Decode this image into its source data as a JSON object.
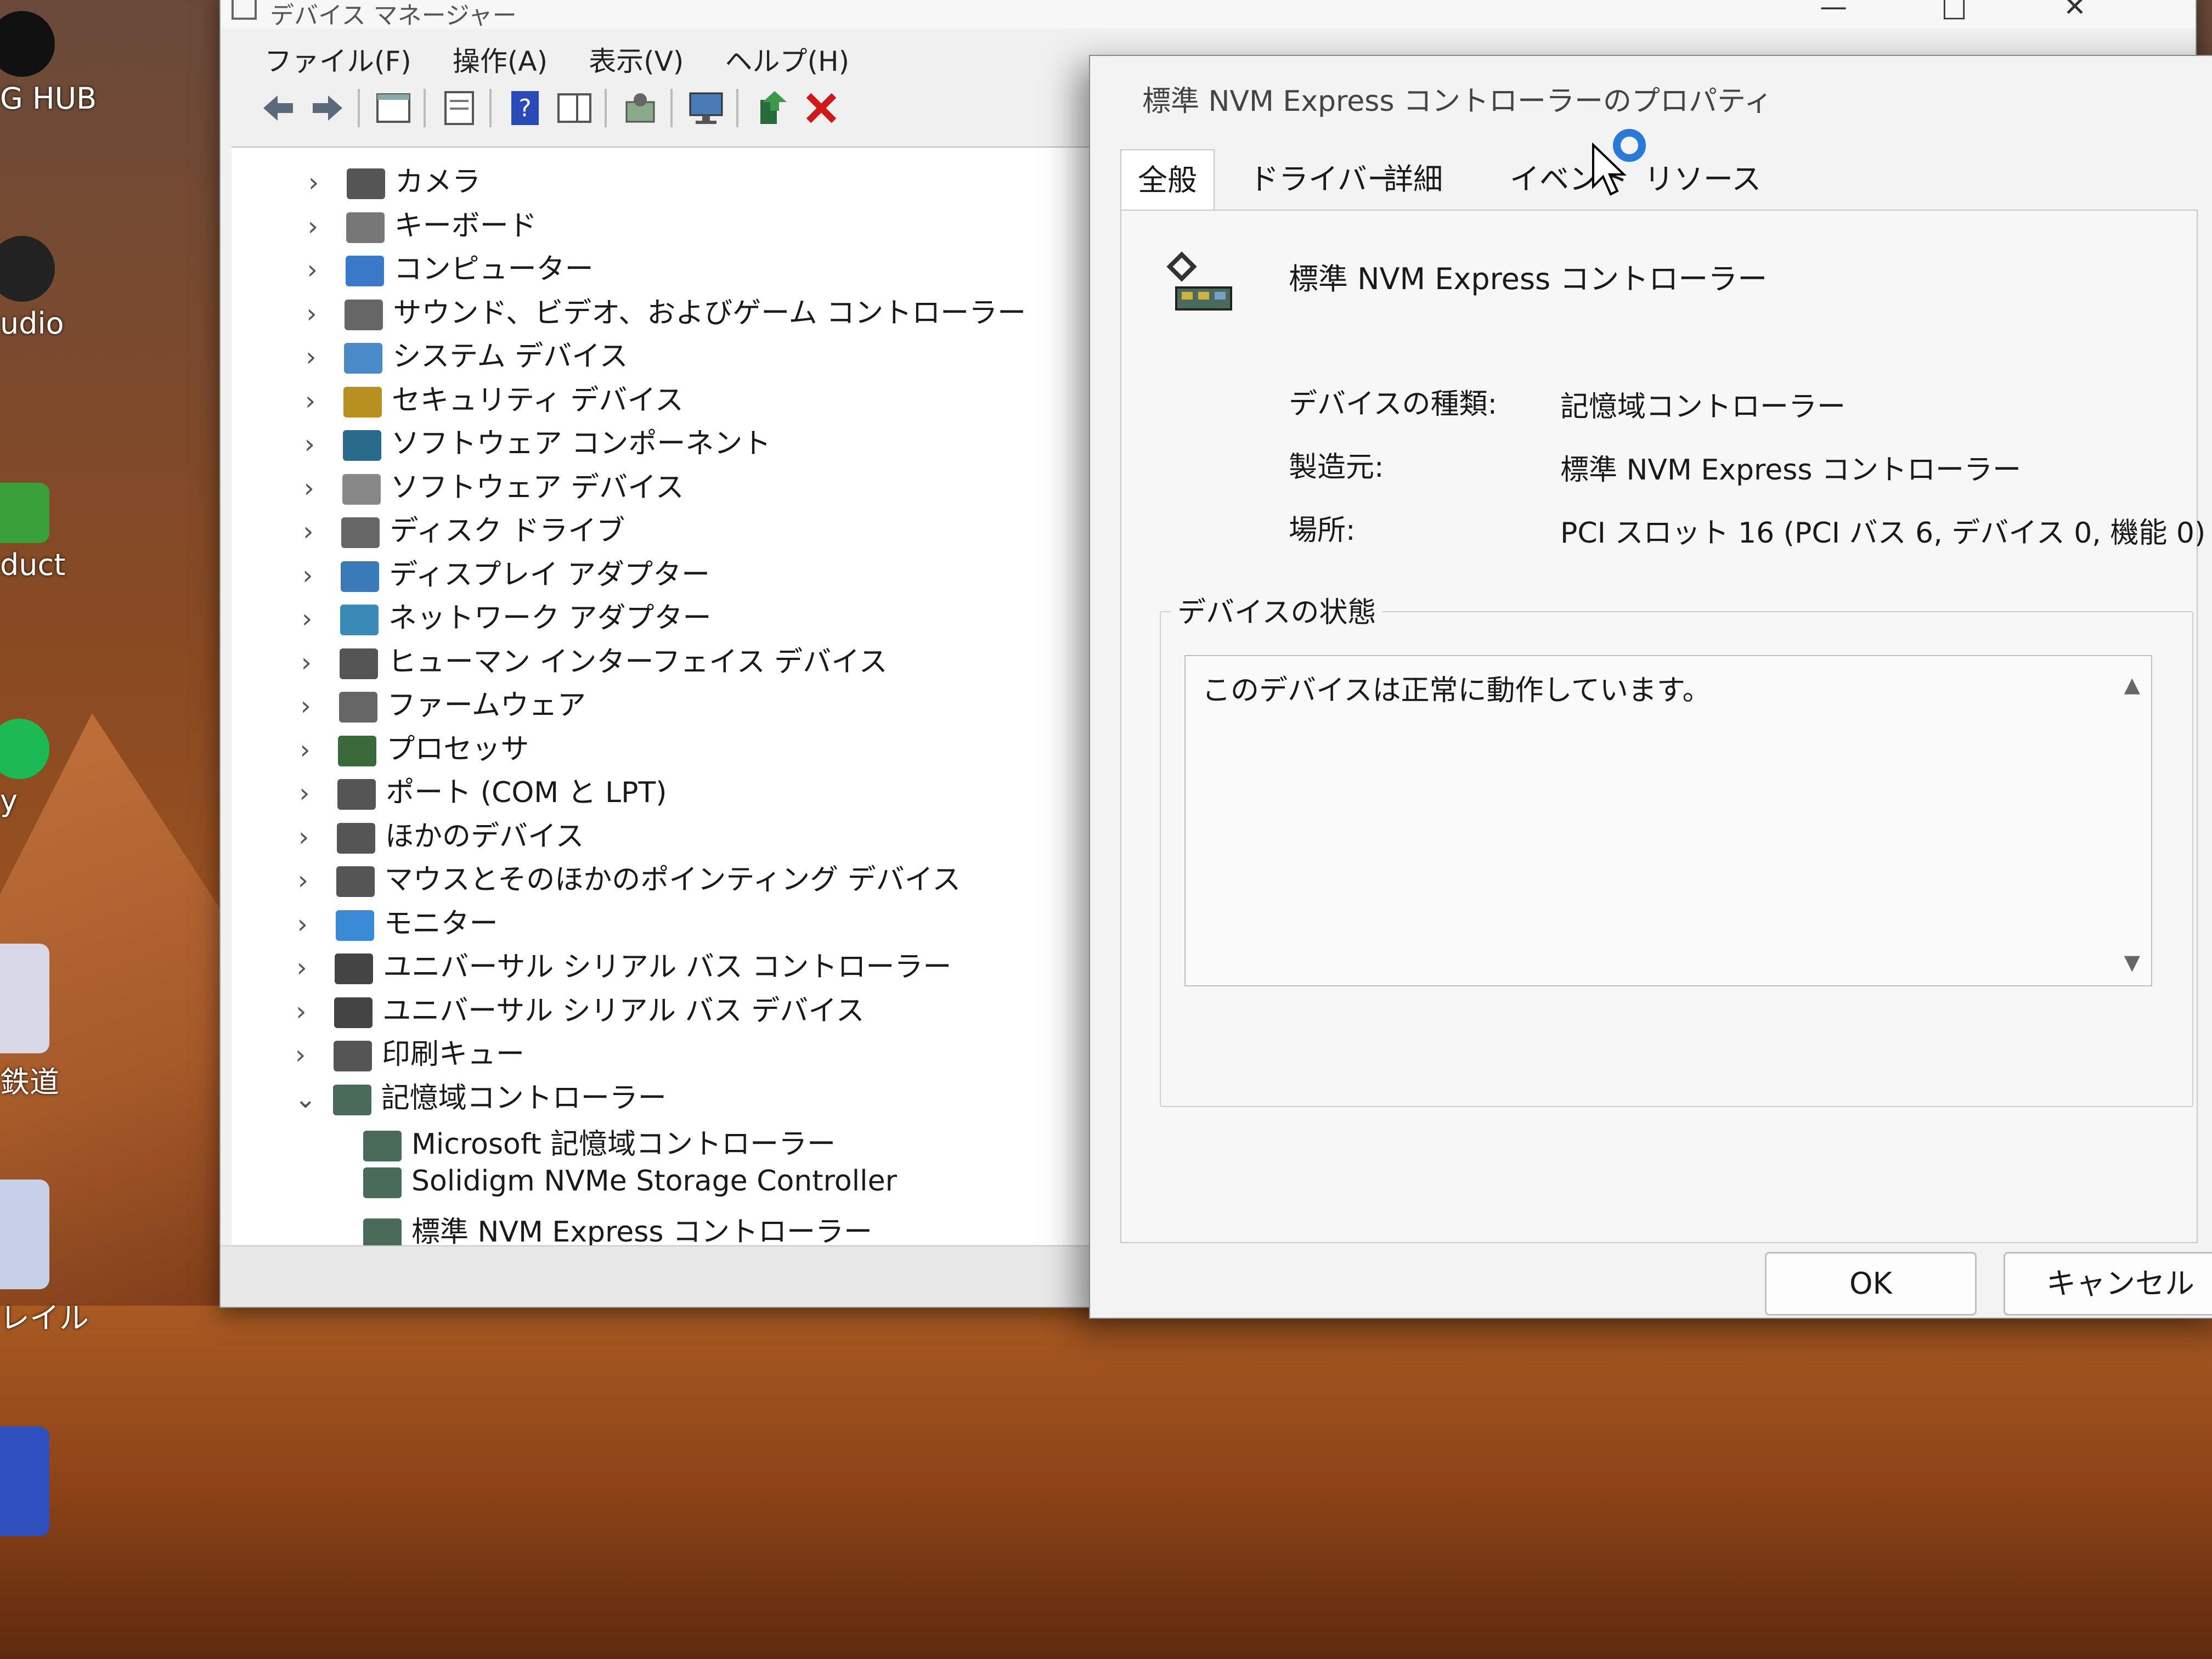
{
  "desktop": {
    "icons": [
      {
        "label": "G HUB",
        "color": "#1a1a1a"
      },
      {
        "label": "udio",
        "color": "#222222"
      },
      {
        "label": "duct",
        "color": "#3aa03a"
      },
      {
        "label": "y",
        "color": "#1db954"
      },
      {
        "label": "鉄道",
        "color": "#d8d8e8"
      },
      {
        "label": "レイル",
        "color": "#c8d0e8"
      },
      {
        "label": "",
        "color": "#3050c0"
      }
    ]
  },
  "device_manager": {
    "title": "デバイス マネージャー",
    "menu": [
      "ファイル(F)",
      "操作(A)",
      "表示(V)",
      "ヘルプ(H)"
    ],
    "tree": [
      {
        "label": "カメラ",
        "expanded": false,
        "icon": "camera-icon"
      },
      {
        "label": "キーボード",
        "expanded": false,
        "icon": "keyboard-icon"
      },
      {
        "label": "コンピューター",
        "expanded": false,
        "icon": "computer-icon"
      },
      {
        "label": "サウンド、ビデオ、およびゲーム コントローラー",
        "expanded": false,
        "icon": "speaker-icon"
      },
      {
        "label": "システム デバイス",
        "expanded": false,
        "icon": "folder-icon"
      },
      {
        "label": "セキュリティ デバイス",
        "expanded": false,
        "icon": "security-key-icon"
      },
      {
        "label": "ソフトウェア コンポーネント",
        "expanded": false,
        "icon": "puzzle-icon"
      },
      {
        "label": "ソフトウェア デバイス",
        "expanded": false,
        "icon": "device-icon"
      },
      {
        "label": "ディスク ドライブ",
        "expanded": false,
        "icon": "disk-icon"
      },
      {
        "label": "ディスプレイ アダプター",
        "expanded": false,
        "icon": "display-adapter-icon"
      },
      {
        "label": "ネットワーク アダプター",
        "expanded": false,
        "icon": "network-icon"
      },
      {
        "label": "ヒューマン インターフェイス デバイス",
        "expanded": false,
        "icon": "hid-icon"
      },
      {
        "label": "ファームウェア",
        "expanded": false,
        "icon": "firmware-icon"
      },
      {
        "label": "プロセッサ",
        "expanded": false,
        "icon": "processor-icon"
      },
      {
        "label": "ポート (COM と LPT)",
        "expanded": false,
        "icon": "port-icon"
      },
      {
        "label": "ほかのデバイス",
        "expanded": false,
        "icon": "unknown-device-icon"
      },
      {
        "label": "マウスとそのほかのポインティング デバイス",
        "expanded": false,
        "icon": "mouse-icon"
      },
      {
        "label": "モニター",
        "expanded": false,
        "icon": "monitor-icon"
      },
      {
        "label": "ユニバーサル シリアル バス コントローラー",
        "expanded": false,
        "icon": "usb-icon"
      },
      {
        "label": "ユニバーサル シリアル バス デバイス",
        "expanded": false,
        "icon": "usb-icon"
      },
      {
        "label": "印刷キュー",
        "expanded": false,
        "icon": "printer-icon"
      },
      {
        "label": "記憶域コントローラー",
        "expanded": true,
        "icon": "storage-controller-icon"
      }
    ],
    "children": [
      "Microsoft 記憶域コントローラー",
      "Solidigm NVMe Storage Controller",
      "標準 NVM Express コントローラー"
    ]
  },
  "dialog": {
    "title": "標準 NVM Express コントローラーのプロパティ",
    "tabs": [
      "全般",
      "ドライバー",
      "詳細",
      "イベント",
      "リソース"
    ],
    "active_tab": "全般",
    "device_name": "標準 NVM Express コントローラー",
    "props": [
      {
        "label": "デバイスの種類:",
        "value": "記憶域コントローラー"
      },
      {
        "label": "製造元:",
        "value": "標準 NVM Express コントローラー"
      },
      {
        "label": "場所:",
        "value": "PCI スロット 16 (PCI バス 6, デバイス 0, 機能 0)"
      }
    ],
    "status_group_label": "デバイスの状態",
    "status_text": "このデバイスは正常に動作しています。",
    "ok_label": "OK",
    "cancel_label": "キャンセル"
  }
}
